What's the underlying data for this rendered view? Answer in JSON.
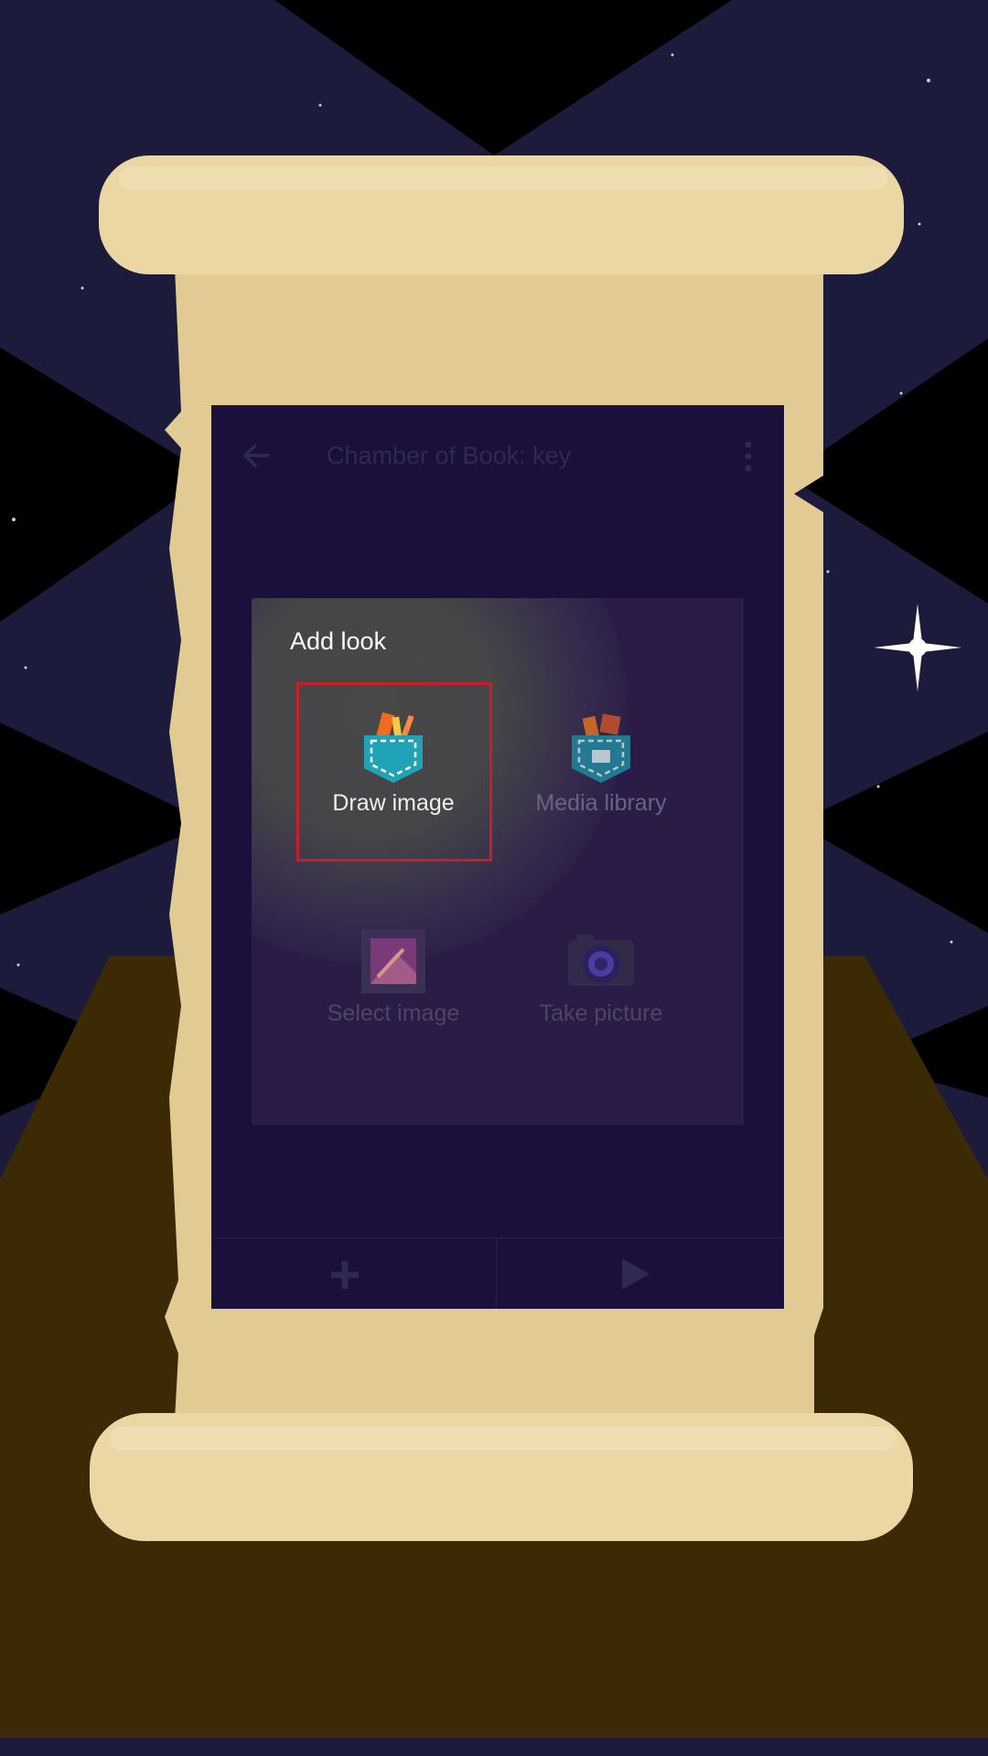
{
  "app": {
    "title": "Chamber of Book: key"
  },
  "dialog": {
    "title": "Add look",
    "options": [
      {
        "label": "Draw image",
        "icon": "draw-pocket-icon",
        "highlighted": true
      },
      {
        "label": "Media library",
        "icon": "media-library-icon"
      },
      {
        "label": "Select image",
        "icon": "gallery-icon"
      },
      {
        "label": "Take picture",
        "icon": "camera-icon"
      }
    ]
  },
  "bottom_bar": {
    "add_icon": "plus-icon",
    "play_icon": "play-icon"
  },
  "colors": {
    "highlight": "#c51f2c",
    "app_background": "#1b0f3b",
    "dialog_background": "#2a1c47",
    "parchment": "#e6d29e",
    "sky": "#1c1b3a",
    "floor": "#3c2a04"
  }
}
